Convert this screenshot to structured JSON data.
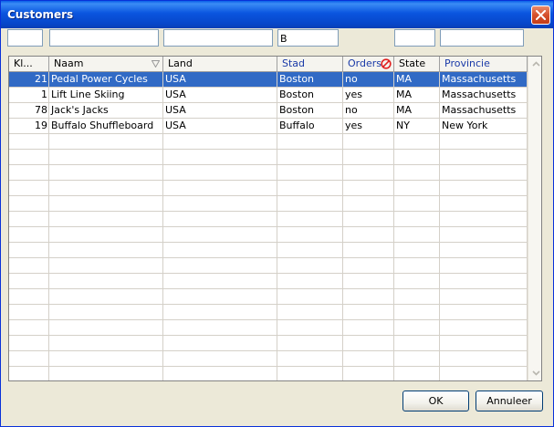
{
  "window": {
    "title": "Customers",
    "accent": "#0a55df",
    "close_icon": "close-icon"
  },
  "filters": [
    "",
    "",
    "",
    "B",
    "",
    ""
  ],
  "grid": {
    "columns": [
      "Kl...",
      "Naam",
      "Land",
      "Stad",
      "Orders",
      "State",
      "Provincie"
    ],
    "rows": [
      {
        "id": "21",
        "naam": "Pedal Power Cycles",
        "land": "USA",
        "stad": "Boston",
        "orders": "no",
        "state": "MA",
        "provincie": "Massachusetts",
        "selected": true
      },
      {
        "id": "1",
        "naam": "Lift Line Skiing",
        "land": "USA",
        "stad": "Boston",
        "orders": "yes",
        "state": "MA",
        "provincie": "Massachusetts",
        "selected": false
      },
      {
        "id": "78",
        "naam": "Jack's Jacks",
        "land": "USA",
        "stad": "Boston",
        "orders": "no",
        "state": "MA",
        "provincie": "Massachusetts",
        "selected": false
      },
      {
        "id": "19",
        "naam": "Buffalo Shuffleboard",
        "land": "USA",
        "stad": "Buffalo",
        "orders": "yes",
        "state": "NY",
        "provincie": "New York",
        "selected": false
      }
    ],
    "selection_color": "#316ac5"
  },
  "buttons": {
    "ok": "OK",
    "cancel": "Annuleer"
  }
}
